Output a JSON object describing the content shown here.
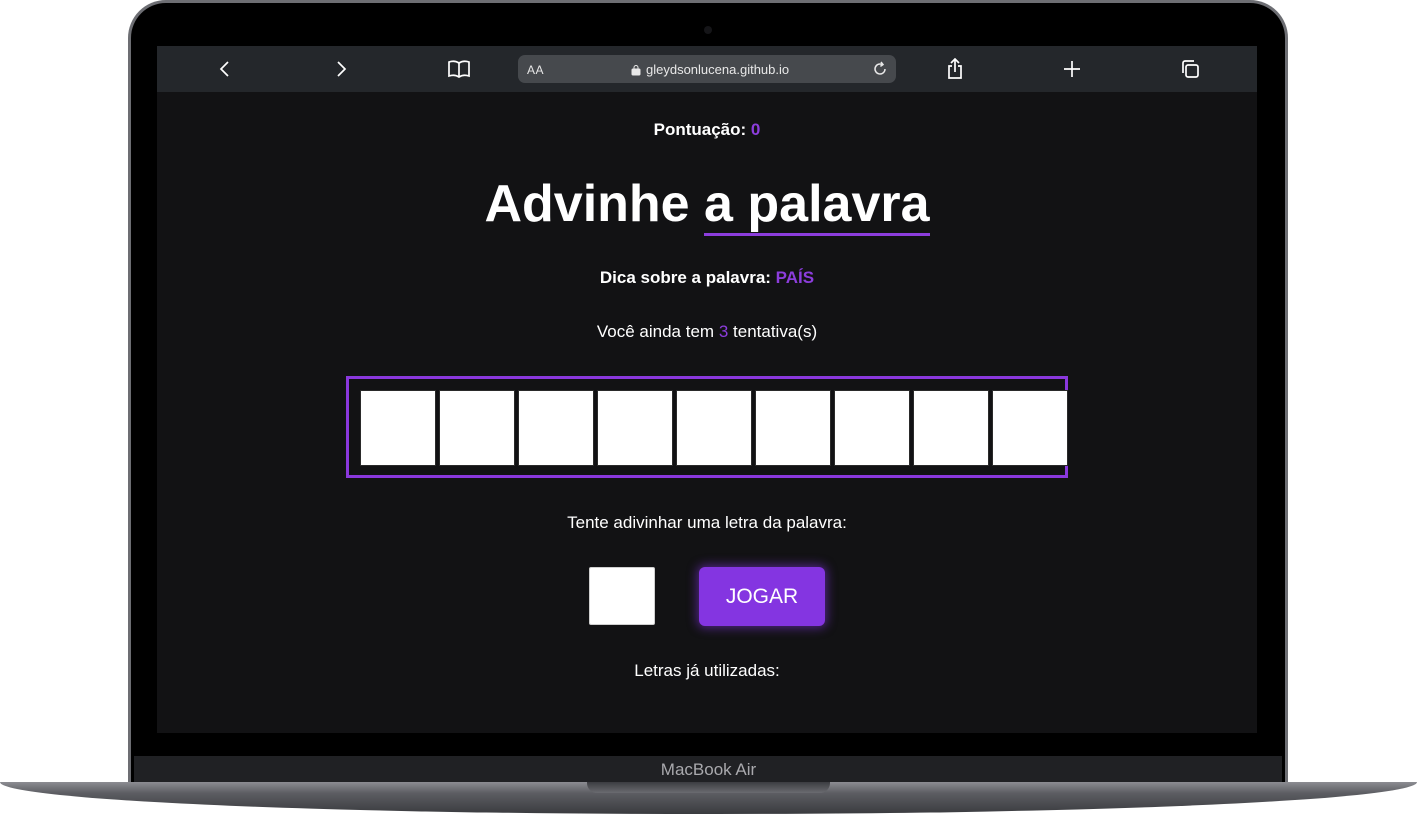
{
  "browser": {
    "text_size_label": "AA",
    "url": "gleydsonlucena.github.io",
    "buttons": [
      "back",
      "forward",
      "bookmarks",
      "share",
      "new-tab",
      "tabs"
    ]
  },
  "game": {
    "score_label": "Pontuação:",
    "score_value": "0",
    "title_part1": "Advinhe",
    "title_part2": "a palavra",
    "hint_label": "Dica sobre a palavra:",
    "hint_value": "PAÍS",
    "tries_prefix": "Você ainda tem",
    "tries_value": "3",
    "tries_suffix": "tentativa(s)",
    "word_length": 9,
    "guess_label": "Tente adivinhar uma letra da palavra:",
    "letter_input_value": "",
    "play_button": "JOGAR",
    "used_letters_label": "Letras já utilizadas:"
  },
  "device": {
    "label": "MacBook Air"
  },
  "colors": {
    "accent": "#8c3ddc",
    "background": "#121214",
    "toolbar": "#24272b"
  }
}
